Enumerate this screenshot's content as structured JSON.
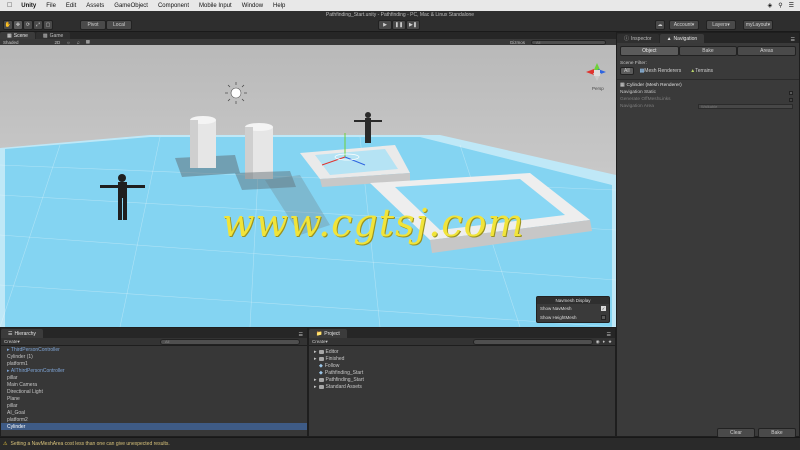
{
  "menubar": {
    "app": "Unity",
    "items": [
      "File",
      "Edit",
      "Assets",
      "GameObject",
      "Component",
      "Mobile Input",
      "Window",
      "Help"
    ]
  },
  "window": {
    "title": "Pathfinding_Start.unity - Pathfinding - PC, Mac & Linux Standalone"
  },
  "toolbar": {
    "pivot_label": "Pivot",
    "local_label": "Local",
    "account_label": "Account",
    "layers_label": "Layers",
    "layout_label": "myLayout"
  },
  "scene": {
    "tabs": [
      "Scene",
      "Game"
    ],
    "shading_mode": "Shaded",
    "mode_2d": "2D",
    "gizmos_label": "Gizmos",
    "search_placeholder": "All",
    "persp_label": "Persp",
    "watermark": "www.cgtsj.com",
    "navmesh_display": {
      "title": "Navmesh Display",
      "show_navmesh": "Show NavMesh",
      "show_heightmesh": "Show HeightMesh",
      "show_navmesh_checked": true,
      "show_heightmesh_checked": false
    }
  },
  "hierarchy": {
    "tab": "Hierarchy",
    "create_label": "Create",
    "search_placeholder": "All",
    "items": [
      {
        "label": "ThirdPersonController",
        "prefab": true,
        "expand": true
      },
      {
        "label": "Cylinder (1)",
        "prefab": false
      },
      {
        "label": "platform1",
        "prefab": false
      },
      {
        "label": "AIThirdPersonController",
        "prefab": true,
        "expand": true
      },
      {
        "label": "pillar",
        "prefab": false
      },
      {
        "label": "Main Camera",
        "prefab": false
      },
      {
        "label": "Directional Light",
        "prefab": false
      },
      {
        "label": "Plane",
        "prefab": false
      },
      {
        "label": "pillar",
        "prefab": false
      },
      {
        "label": "AI_Goal",
        "prefab": false
      },
      {
        "label": "platform2",
        "prefab": false
      },
      {
        "label": "Cylinder",
        "prefab": false,
        "selected": true
      }
    ]
  },
  "project": {
    "tab": "Project",
    "create_label": "Create",
    "items": [
      {
        "label": "Editor",
        "type": "folder"
      },
      {
        "label": "Finished",
        "type": "folder"
      },
      {
        "label": "Follow",
        "type": "scene"
      },
      {
        "label": "Pathfinding_Start",
        "type": "scene"
      },
      {
        "label": "Pathfinding_Start",
        "type": "folder"
      },
      {
        "label": "Standard Assets",
        "type": "folder"
      }
    ]
  },
  "inspector": {
    "tabs": [
      "Inspector",
      "Navigation"
    ],
    "subtabs": [
      "Object",
      "Bake",
      "Areas"
    ],
    "scene_filter_label": "Scene Filter:",
    "filters": [
      "All",
      "Mesh Renderers",
      "Terrains"
    ],
    "object_title": "Cylinder (Mesh Renderer)",
    "navigation_static": "Navigation Static",
    "generate_offmeshlinks": "Generate OffMeshLinks",
    "navigation_area": "Navigation Area",
    "navigation_area_value": "Walkable",
    "clear_label": "Clear",
    "bake_label": "Bake"
  },
  "status": {
    "message": "Setting a NavMeshArea cost less than one can give unexpected results."
  },
  "colors": {
    "navmesh": "#7fd3f5",
    "watermark": "#f1e43a",
    "prefab_text": "#7fa6d8",
    "selection": "#3e5b86"
  }
}
